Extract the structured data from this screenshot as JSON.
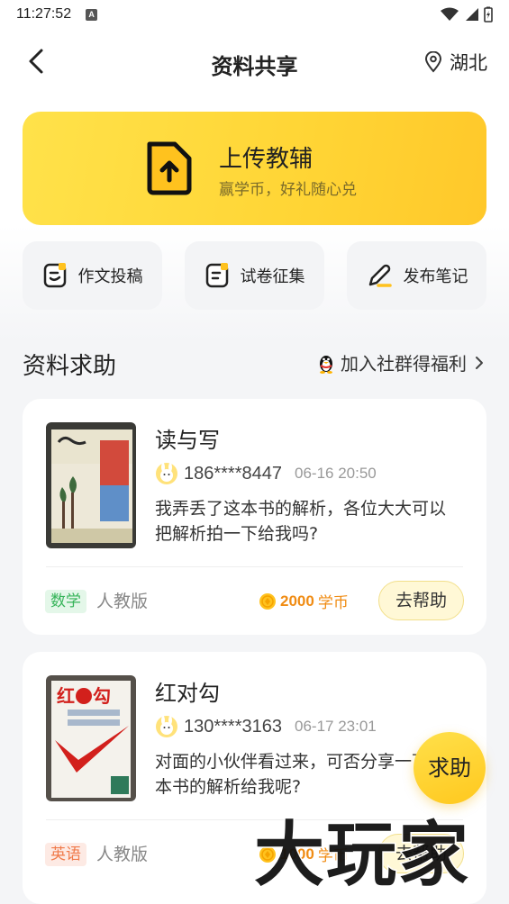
{
  "status_bar": {
    "time": "11:27:52",
    "badge": "A"
  },
  "header": {
    "title": "资料共享",
    "location": "湖北"
  },
  "upload": {
    "title": "上传教辅",
    "subtitle": "赢学币，好礼随心兑"
  },
  "quick_actions": [
    {
      "label": "作文投稿",
      "icon": "essay-icon"
    },
    {
      "label": "试卷征集",
      "icon": "paper-icon"
    },
    {
      "label": "发布笔记",
      "icon": "note-pen-icon"
    }
  ],
  "section": {
    "title": "资料求助",
    "join_label": "加入社群得福利"
  },
  "requests": [
    {
      "title": "读与写",
      "user": "186****8447",
      "time": "06-16 20:50",
      "description": "我弄丢了这本书的解析，各位大大可以把解析拍一下给我吗?",
      "subject": "数学",
      "edition": "人教版",
      "coins": "2000",
      "coin_unit": "学币",
      "action": "去帮助"
    },
    {
      "title": "红对勾",
      "user": "130****3163",
      "time": "06-17 23:01",
      "description": "对面的小伙伴看过来，可否分享一下这本书的解析给我呢?",
      "subject": "英语",
      "edition": "人教版",
      "coins": "1000",
      "coin_unit": "学币",
      "action": "去帮助"
    }
  ],
  "fab_label": "求助",
  "watermark": "大玩家",
  "colors": {
    "accent": "#ffd535",
    "coin": "#f08c14",
    "math_tag": "#37b45a",
    "english_tag": "#f07a4a"
  }
}
